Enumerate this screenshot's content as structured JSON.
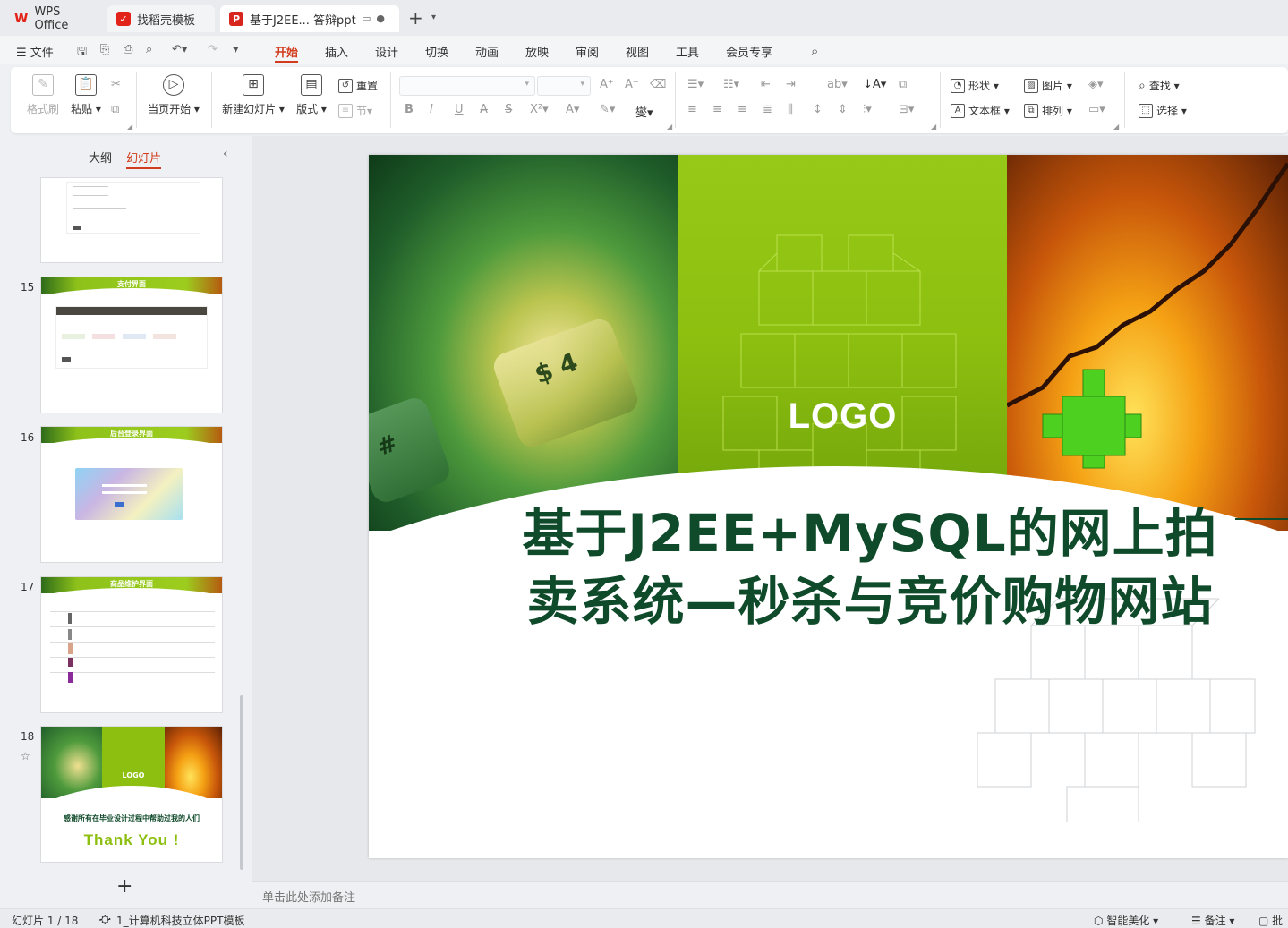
{
  "tabs": {
    "wps": "WPS Office",
    "template": "找稻壳模板",
    "document": "基于J2EE... 答辩ppt"
  },
  "menu": {
    "file": "文件",
    "items": [
      "开始",
      "插入",
      "设计",
      "切换",
      "动画",
      "放映",
      "审阅",
      "视图",
      "工具",
      "会员专享"
    ],
    "active": "开始"
  },
  "ribbon": {
    "format_painter": "格式刷",
    "paste": "粘贴",
    "start_from_current": "当页开始",
    "new_slide": "新建幻灯片",
    "layout": "版式",
    "reset": "重置",
    "section": "节",
    "shape": "形状",
    "picture": "图片",
    "textbox": "文本框",
    "arrange": "排列",
    "find": "查找",
    "select": "选择"
  },
  "left_panel": {
    "tab_outline": "大纲",
    "tab_slides": "幻灯片",
    "thumbnails": [
      {
        "number": "15",
        "title": "支付界面"
      },
      {
        "number": "16",
        "title": "后台登录界面"
      },
      {
        "number": "17",
        "title": "商品维护界面"
      },
      {
        "number": "18",
        "title": "",
        "logo": "LOGO",
        "caption": "感谢所有在毕业设计过程中帮助过我的人们",
        "thanks": "Thank You !"
      }
    ]
  },
  "slide": {
    "logo": "LOGO",
    "title_line1": "基于J2EE+MySQL的网上拍",
    "title_line2": "卖系统—秒杀与竞价购物网站"
  },
  "notes_placeholder": "单击此处添加备注",
  "status": {
    "slide_counter": "幻灯片 1 / 18",
    "template_name": "1_计算机科技立体PPT模板",
    "smart_beautify": "智能美化",
    "notes": "备注",
    "comments": "批"
  },
  "colors": {
    "accent": "#d23c1c",
    "slide_title": "#0f4a2a",
    "green_panel": "#8dbf10"
  }
}
